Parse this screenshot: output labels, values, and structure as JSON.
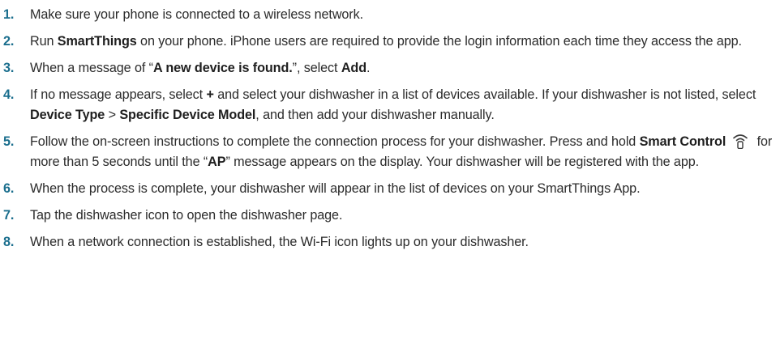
{
  "steps": [
    {
      "num": "1.",
      "text": "Make sure your phone is connected to a wireless network."
    },
    {
      "num": "2.",
      "t1": "Run ",
      "b1": "SmartThings",
      "t2": " on your phone. iPhone users are required to provide the login information each time they access the app."
    },
    {
      "num": "3.",
      "t1": "When a message of “",
      "b1": "A new device is found.",
      "t2": "”, select ",
      "b2": "Add",
      "t3": "."
    },
    {
      "num": "4.",
      "t1": "If no message appears, select ",
      "b1": "+",
      "t2": " and select your dishwasher in a list of devices available. If your dishwasher is not listed, select ",
      "b2": "Device Type",
      "t3": " > ",
      "b3": "Specific Device Model",
      "t4": ", and then add your dishwasher manually."
    },
    {
      "num": "5.",
      "t1": "Follow the on-screen instructions to complete the connection process for your dishwasher. Press and hold ",
      "b1": "Smart Control",
      "icon": "smart-control-wifi-icon",
      "t2": " for more than 5 seconds until the “",
      "b2": "AP",
      "t3": "” message appears on the display. Your dishwasher will be registered with the app."
    },
    {
      "num": "6.",
      "text": "When the process is complete, your dishwasher will appear in the list of devices on your SmartThings App."
    },
    {
      "num": "7.",
      "text": "Tap the dishwasher icon to open the dishwasher page."
    },
    {
      "num": "8.",
      "text": "When a network connection is established, the Wi-Fi icon lights up on your dishwasher."
    }
  ]
}
